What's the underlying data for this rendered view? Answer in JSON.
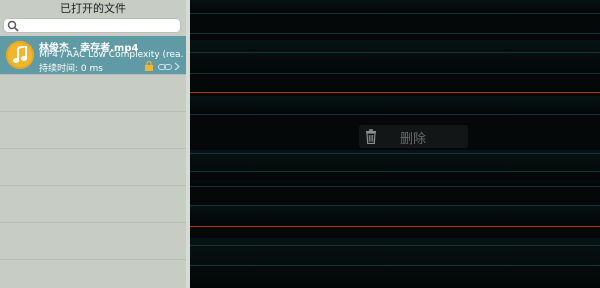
{
  "sidebar": {
    "title": "已打开的文件",
    "search": {
      "placeholder": ""
    },
    "files": [
      {
        "title": "林俊杰 - 幸存者.mp4",
        "codec": "MP4 / AAC Low Complexity (rea...",
        "duration": "持续时间: 0 ms",
        "icon": "music-note-icon"
      }
    ]
  },
  "main": {
    "context_action": {
      "label": "删除",
      "icon": "trash-icon"
    }
  },
  "colors": {
    "sidebar_bg": "#c7ccc5",
    "selected_row": "#5f9aa5",
    "avatar": "#f1b630",
    "main_bg": "#050808",
    "grid_line": "#13393b",
    "accent_line": "#b1381f"
  }
}
